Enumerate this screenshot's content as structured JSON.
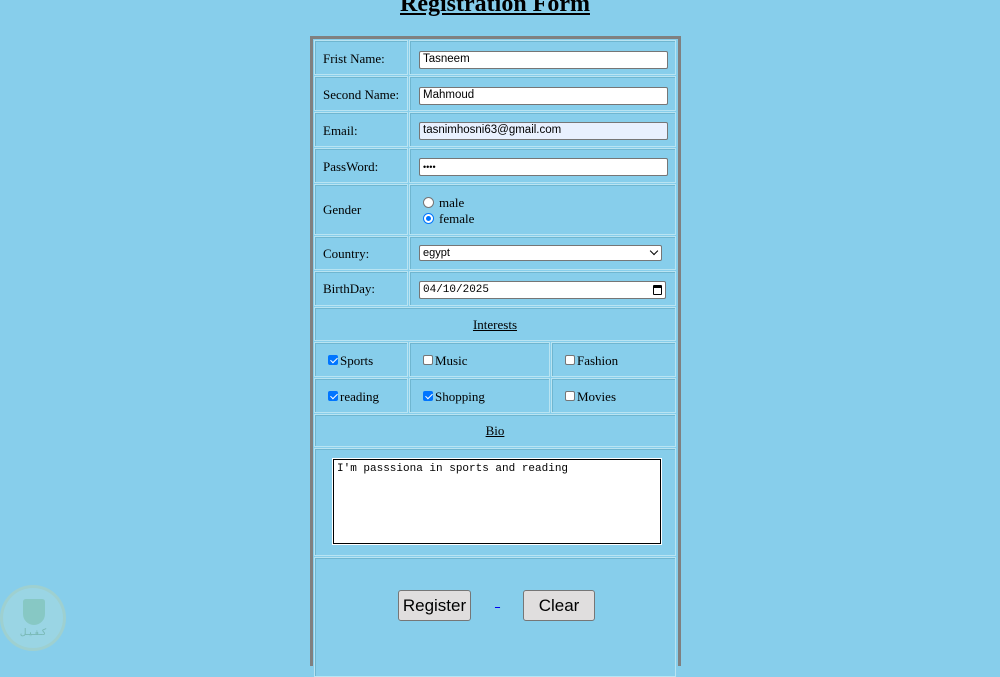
{
  "page": {
    "title": "Registration Form"
  },
  "form": {
    "first_name_label": "Frist Name:",
    "first_name_value": "Tasneem",
    "second_name_label": "Second Name:",
    "second_name_value": " Mahmoud",
    "email_label": "Email:",
    "email_value": "tasnimhosni63@gmail.com",
    "password_label": "PassWord:",
    "password_value": "••••",
    "gender_label": "Gender",
    "gender_options": [
      {
        "label": "male",
        "selected": false
      },
      {
        "label": "female",
        "selected": true
      }
    ],
    "country_label": "Country:",
    "country_value": "egypt",
    "birthday_label": "BirthDay:",
    "birthday_value": "04/10/2025",
    "interests_heading": "Interests",
    "interests": [
      {
        "label": "Sports",
        "checked": true
      },
      {
        "label": "Music",
        "checked": false
      },
      {
        "label": "Fashion",
        "checked": false
      },
      {
        "label": "reading",
        "checked": true
      },
      {
        "label": "Shopping",
        "checked": true
      },
      {
        "label": "Movies",
        "checked": false
      }
    ],
    "bio_heading": "Bio",
    "bio_value": "I'm passsiona in sports and reading",
    "register_label": "Register",
    "clear_label": "Clear",
    "link_text": "_"
  },
  "watermark": {
    "icon": "shield-icon",
    "text": "كـفـيـل"
  },
  "colors": {
    "background": "#87ceeb",
    "accent": "#0075ff",
    "button": "#e0dede"
  }
}
